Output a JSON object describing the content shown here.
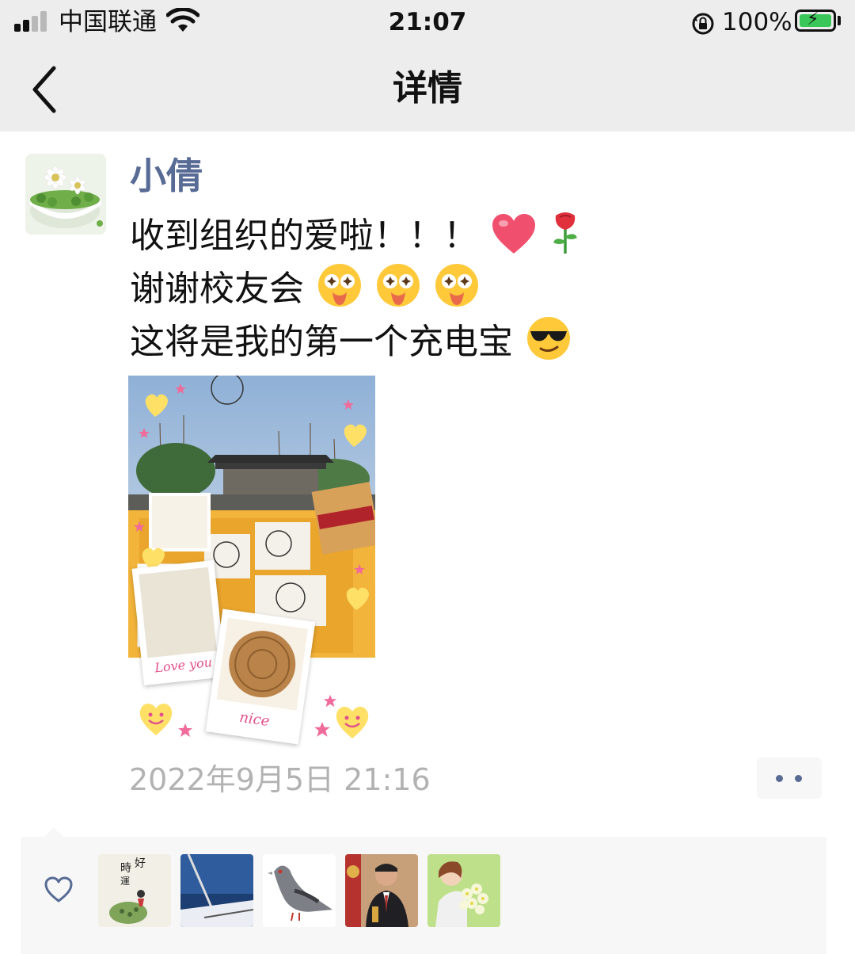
{
  "status_bar": {
    "carrier": "中国联通",
    "time": "21:07",
    "battery_percent": "100%",
    "signal_bars": 4,
    "signal_bars_active": 2,
    "battery_charging": true
  },
  "nav": {
    "title": "详情",
    "back_icon": "chevron-left-icon"
  },
  "post": {
    "author": "小倩",
    "lines": [
      {
        "text": "收到组织的爱啦！！！",
        "emojis": [
          "red-heart",
          "rose"
        ]
      },
      {
        "text": "谢谢校友会",
        "emojis": [
          "starry-eyed-tongue",
          "starry-eyed-tongue",
          "starry-eyed-tongue"
        ]
      },
      {
        "text": "这将是我的第一个充电宝",
        "emojis": [
          "sunglasses-face"
        ]
      }
    ],
    "photo_stickers": [
      "Love you",
      "nice"
    ],
    "timestamp": "2022年9月5日 21:16"
  },
  "likes": {
    "icon": "heart-outline-icon",
    "avatar_count": 5
  },
  "colors": {
    "bar_background": "#ededed",
    "author_name": "#576b95",
    "timestamp": "#b2b2b2",
    "likes_panel": "#f7f7f7"
  }
}
